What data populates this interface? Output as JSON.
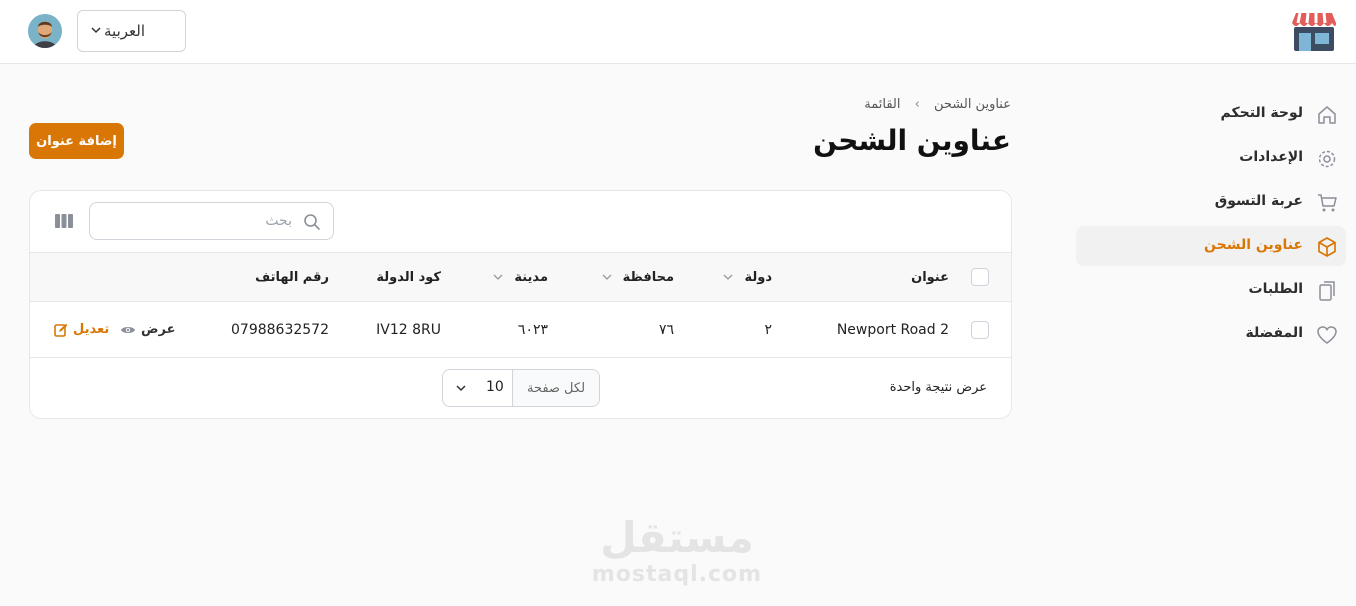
{
  "header": {
    "language": "العربية"
  },
  "sidebar": {
    "items": [
      {
        "label": "لوحة التحكم",
        "icon": "home-icon"
      },
      {
        "label": "الإعدادات",
        "icon": "gear-icon"
      },
      {
        "label": "عربة التسوق",
        "icon": "cart-icon"
      },
      {
        "label": "عناوين الشحن",
        "icon": "box-icon",
        "active": true
      },
      {
        "label": "الطلبات",
        "icon": "clipboard-icon"
      },
      {
        "label": "المفضلة",
        "icon": "heart-icon"
      }
    ]
  },
  "breadcrumb": {
    "first": "عناوين الشحن",
    "second": "القائمة"
  },
  "page": {
    "title": "عناوين الشحن",
    "add_button": "إضافة عنوان"
  },
  "search": {
    "placeholder": "بحث"
  },
  "table": {
    "columns": {
      "address": "عنوان",
      "country": "دولة",
      "province": "محافظة",
      "city": "مدينة",
      "postal_code": "كود الدولة",
      "phone": "رقم الهاتف"
    },
    "rows": [
      {
        "address": "Newport Road 2",
        "country": "٢",
        "province": "٧٦",
        "city": "٦٠٢٣",
        "postal_code": "IV12 8RU",
        "phone": "07988632572",
        "view": "عرض",
        "edit": "تعديل"
      }
    ],
    "footer": {
      "results": "عرض نتيجة واحدة",
      "per_page_label": "لكل صفحة",
      "per_page_value": "10"
    }
  },
  "watermark": {
    "arabic": "مستقل",
    "latin": "mostaql.com"
  },
  "colors": {
    "accent": "#d97706",
    "background": "#fafafa"
  }
}
